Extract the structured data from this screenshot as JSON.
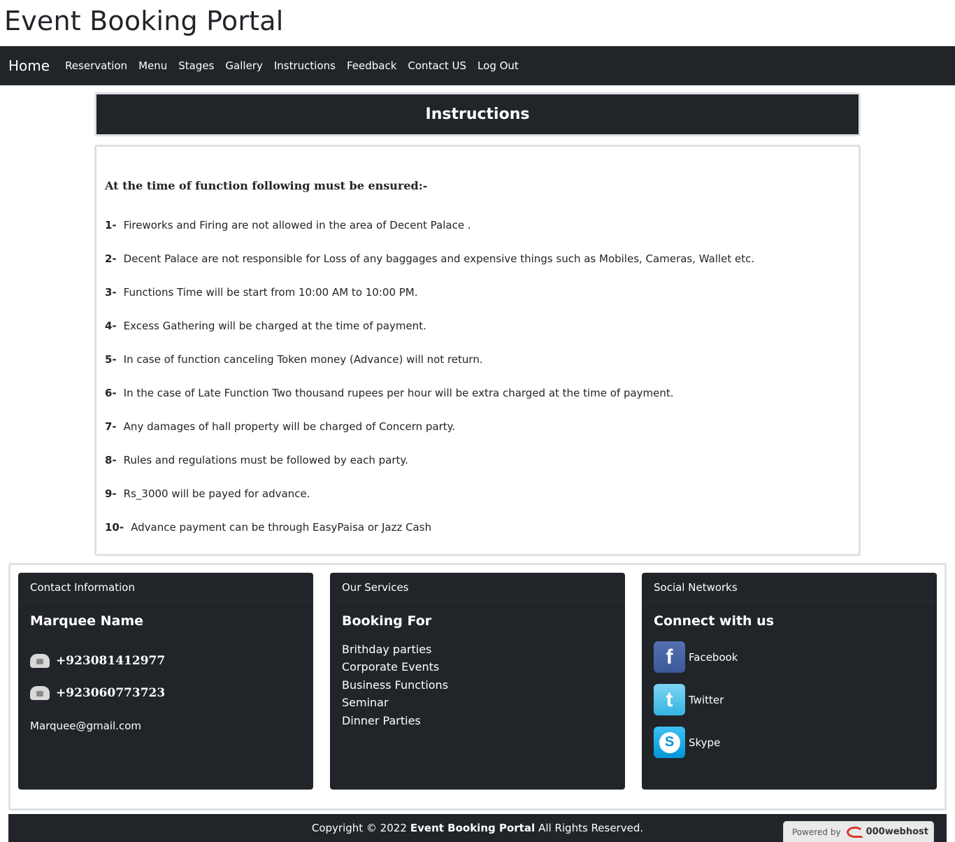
{
  "site": {
    "title": "Event Booking Portal"
  },
  "nav": {
    "brand": "Home",
    "links": [
      "Reservation",
      "Menu",
      "Stages",
      "Gallery",
      "Instructions",
      "Feedback",
      "Contact US",
      "Log Out"
    ]
  },
  "page": {
    "heading": "Instructions",
    "intro": "At the time of function following must be ensured:-",
    "rules": [
      {
        "num": "1-",
        "text": "Fireworks and Firing are not allowed in the area of Decent Palace ."
      },
      {
        "num": "2-",
        "text": "Decent Palace are not responsible for Loss of any baggages and expensive things such as Mobiles, Cameras, Wallet etc."
      },
      {
        "num": "3-",
        "text": "Functions Time will be start from 10:00 AM to 10:00 PM."
      },
      {
        "num": "4-",
        "text": "Excess Gathering will be charged at the time of payment."
      },
      {
        "num": "5-",
        "text": "In case of function canceling Token money (Advance) will not return."
      },
      {
        "num": "6-",
        "text": "In the case of Late Function Two thousand rupees per hour will be extra charged at the time of payment."
      },
      {
        "num": "7-",
        "text": "Any damages of hall property will be charged of Concern party."
      },
      {
        "num": "8-",
        "text": "Rules and regulations must be followed by each party."
      },
      {
        "num": "9-",
        "text": "Rs_3000 will be payed for advance."
      },
      {
        "num": "10-",
        "text": "Advance payment can be through EasyPaisa or Jazz Cash"
      }
    ]
  },
  "footer": {
    "contact": {
      "header": "Contact Information",
      "title": "Marquee Name",
      "phones": [
        "+923081412977",
        "+923060773723"
      ],
      "email": "Marquee@gmail.com"
    },
    "services": {
      "header": "Our Services",
      "title": "Booking For",
      "items": [
        "Brithday parties",
        "Corporate Events",
        "Business Functions",
        "Seminar",
        "Dinner Parties"
      ]
    },
    "social": {
      "header": "Social Networks",
      "title": "Connect with us",
      "networks": [
        {
          "name": "Facebook",
          "icon": "facebook-icon",
          "glyph": "f"
        },
        {
          "name": "Twitter",
          "icon": "twitter-icon",
          "glyph": "t"
        },
        {
          "name": "Skype",
          "icon": "skype-icon",
          "glyph": "S"
        }
      ]
    }
  },
  "copyright": {
    "prefix": "Copyright © 2022",
    "brand": "Event Booking Portal",
    "suffix": "All Rights Reserved."
  },
  "powered": {
    "label": "Powered by",
    "brand": "000webhost"
  },
  "colors": {
    "dark": "#212529",
    "border": "#dee2e6",
    "facebook": "#3b5998",
    "twitter": "#33b4e4",
    "skype": "#0096d8"
  }
}
